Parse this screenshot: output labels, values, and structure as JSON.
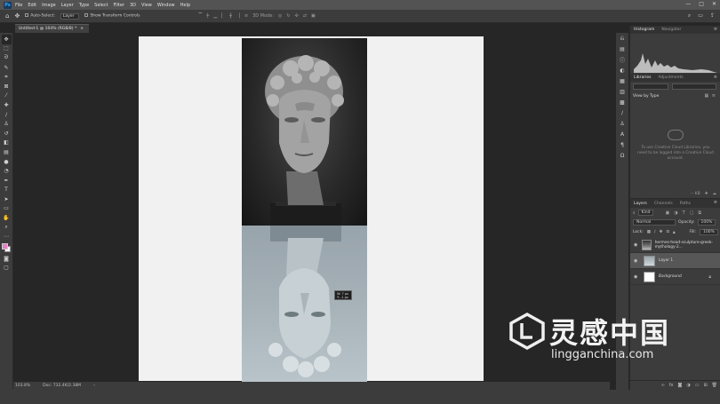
{
  "app": {
    "logo": "Ps"
  },
  "menu": [
    "File",
    "Edit",
    "Image",
    "Layer",
    "Type",
    "Select",
    "Filter",
    "3D",
    "View",
    "Window",
    "Help"
  ],
  "window_controls": [
    "—",
    "□",
    "✕"
  ],
  "options": {
    "auto_select_label": "Auto-Select:",
    "auto_select_value": "Layer",
    "show_transform_label": "Show Transform Controls",
    "mode_3d": "3D Mode:"
  },
  "document_tab": {
    "title": "Untitled-1 @ 104% (RGB/8) *",
    "close": "×"
  },
  "tooltip": {
    "w": "W: 7 px",
    "h": "Y: -1 px"
  },
  "status": {
    "zoom": "103.8%",
    "doc": "Doc: 732.4K/2.38M",
    "arrow": "›"
  },
  "panels": {
    "histogram_tabs": [
      "Histogram",
      "Navigator"
    ],
    "libraries_tabs": [
      "Libraries",
      "Adjustments"
    ],
    "view_by": "View by Type",
    "library_message": "To use Creative Cloud Libraries, you need to be logged into a Creative Cloud account.",
    "library_size": "-- KB",
    "layers_tabs": [
      "Layers",
      "Channels",
      "Paths"
    ],
    "filter_kind": "Kind",
    "blend_mode": "Normal",
    "opacity_label": "Opacity:",
    "opacity_value": "100%",
    "lock_label": "Lock:",
    "fill_label": "Fill:",
    "fill_value": "100%",
    "layers": [
      {
        "name": "hermes-head-sculpture-greek-mythology-2...",
        "selected": false
      },
      {
        "name": "Layer 1",
        "selected": true
      },
      {
        "name": "Background",
        "selected": false
      }
    ]
  },
  "watermark": {
    "title": "灵感中国",
    "url": "lingganchina.com"
  },
  "colors": {
    "foreground": "#e77fc3",
    "background": "#ffffff",
    "canvas_bg": "#262626",
    "doc_bg": "#f1f1f1"
  }
}
